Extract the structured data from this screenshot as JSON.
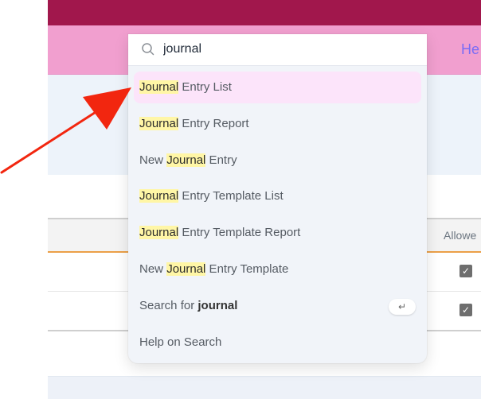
{
  "navbar": {
    "help_label": "He"
  },
  "table": {
    "header_allowed": "Allowe",
    "rows": [
      {
        "allowed_checked": true,
        "check_glyph": "✓"
      },
      {
        "allowed_checked": true,
        "check_glyph": "✓"
      }
    ]
  },
  "search": {
    "query": "journal",
    "placeholder": "",
    "results": [
      {
        "pre": "",
        "match": "Journal",
        "post": " Entry List",
        "active": true
      },
      {
        "pre": "",
        "match": "Journal",
        "post": " Entry Report",
        "active": false
      },
      {
        "pre": "New ",
        "match": "Journal",
        "post": " Entry",
        "active": false
      },
      {
        "pre": "",
        "match": "Journal",
        "post": " Entry Template List",
        "active": false
      },
      {
        "pre": "",
        "match": "Journal",
        "post": " Entry Template Report",
        "active": false
      },
      {
        "pre": "New ",
        "match": "Journal",
        "post": " Entry Template",
        "active": false
      }
    ],
    "search_for_prefix": "Search for ",
    "search_for_term": "journal",
    "enter_key_glyph": "↵",
    "help_label": "Help on Search"
  },
  "annotation": {
    "arrow_color": "#f2260f"
  },
  "colors": {
    "topbar": "#a1174c",
    "navbar": "#f19fcf",
    "active_result": "#fce4fa",
    "highlight": "#fff6a6"
  }
}
